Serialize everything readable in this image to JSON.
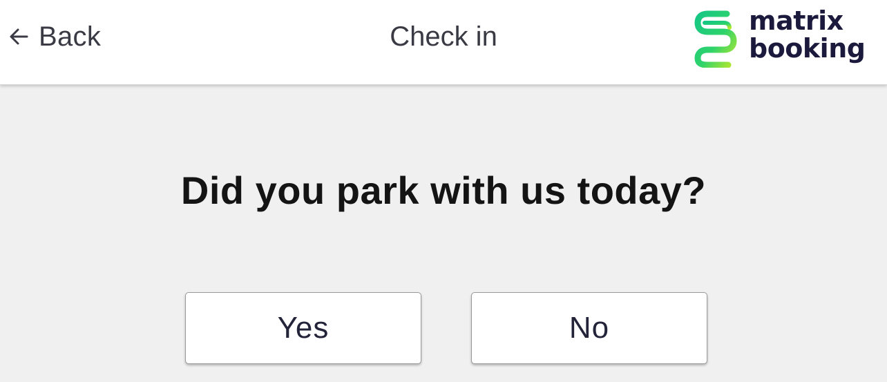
{
  "header": {
    "back_label": "Back",
    "back_icon": "arrow-left-icon",
    "title": "Check in",
    "logo": {
      "line1": "matrix",
      "line2": "booking",
      "mark_colors": [
        "#2ecc71",
        "#a3e635",
        "#22c55e"
      ]
    }
  },
  "prompt": {
    "question": "Did you park with us today?",
    "yes_label": "Yes",
    "no_label": "No"
  },
  "colors": {
    "header_bg": "#ffffff",
    "page_bg": "#f0f0f0",
    "text_dark": "#141414",
    "logo_text": "#1b1a3d",
    "logo_green": "#2ecc71"
  }
}
